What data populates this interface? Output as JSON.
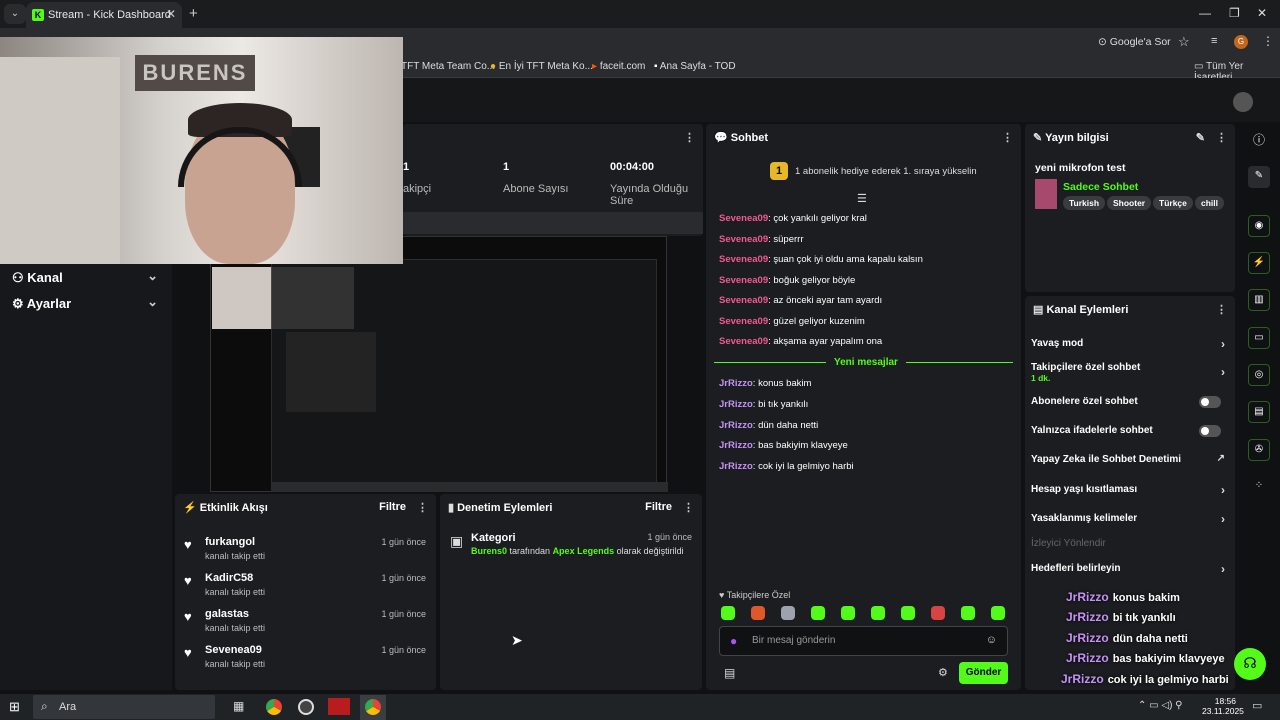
{
  "browser": {
    "tab_title": "Stream - Kick Dashboard",
    "address_actions": {
      "google_ask": "Google'a Sor"
    },
    "bookmarks": [
      "TFT Meta Team Co...",
      "En İyi TFT Meta Ko...",
      "faceit.com",
      "Ana Sayfa - TOD"
    ],
    "all_bookmarks": "Tüm Yer İşaretleri"
  },
  "webcam": {
    "sign_text": "BURENS"
  },
  "leftnav": {
    "items": [
      {
        "label": "Kanal"
      },
      {
        "label": "Ayarlar"
      }
    ]
  },
  "stats": {
    "items": [
      {
        "value": "1",
        "label": "akipçi"
      },
      {
        "value": "1",
        "label": "Abone Sayısı"
      },
      {
        "value": "00:04:00",
        "label": "Yayında Olduğu Süre"
      }
    ]
  },
  "activity": {
    "title": "Etkinlik Akışı",
    "filter": "Filtre",
    "items": [
      {
        "name": "furkangol",
        "sub": "kanalı takip etti",
        "time": "1 gün önce"
      },
      {
        "name": "KadirC58",
        "sub": "kanalı takip etti",
        "time": "1 gün önce"
      },
      {
        "name": "galastas",
        "sub": "kanalı takip etti",
        "time": "1 gün önce"
      },
      {
        "name": "Sevenea09",
        "sub": "kanalı takip etti",
        "time": "1 gün önce"
      }
    ]
  },
  "modlog": {
    "title": "Denetim Eylemleri",
    "filter": "Filtre",
    "item": {
      "title": "Kategori",
      "time": "1 gün önce",
      "actor": "Burens0",
      "mid": " tarafından ",
      "game": "Apex Legends",
      "tail": " olarak değiştirildi"
    }
  },
  "chat": {
    "title": "Sohbet",
    "promo": "1 abonelik hediye ederek 1. sıraya yükselin",
    "promo_num": "1",
    "messages": [
      {
        "user": "Sevenea09",
        "text": ": çok yankılı geliyor kral",
        "color": "pink"
      },
      {
        "user": "Sevenea09",
        "text": ": süperrr",
        "color": "pink"
      },
      {
        "user": "Sevenea09",
        "text": ": şuan çok iyi oldu ama kapalu kalsın",
        "color": "pink"
      },
      {
        "user": "Sevenea09",
        "text": ": boğuk geliyor böyle",
        "color": "pink"
      },
      {
        "user": "Sevenea09",
        "text": ": az önceki ayar tam ayardı",
        "color": "pink"
      },
      {
        "user": "Sevenea09",
        "text": ": güzel geliyor kuzenim",
        "color": "pink"
      },
      {
        "user": "Sevenea09",
        "text": ": akşama ayar yapalım ona",
        "color": "pink"
      },
      {
        "user": "JrRizzo",
        "text": ": konus bakim",
        "color": "purple"
      },
      {
        "user": "JrRizzo",
        "text": ": bi tık yankılı",
        "color": "purple"
      },
      {
        "user": "JrRizzo",
        "text": ": dün daha netti",
        "color": "purple"
      },
      {
        "user": "JrRizzo",
        "text": ": bas bakiyim klavyeye",
        "color": "purple"
      },
      {
        "user": "JrRizzo",
        "text": ": cok iyi la gelmiyo harbi",
        "color": "purple"
      }
    ],
    "new_messages": "Yeni mesajlar",
    "followers_only": "Takipçilere Özel",
    "input_placeholder": "Bir mesaj gönderin",
    "send": "Gönder"
  },
  "info": {
    "title": "Yayın bilgisi",
    "stream_title": "yeni mikrofon test",
    "category": "Sadece Sohbet",
    "tags": [
      "Turkish",
      "Shooter",
      "Türkçe",
      "chill"
    ]
  },
  "actions": {
    "title": "Kanal Eylemleri",
    "items": [
      {
        "label": "Yavaş mod"
      },
      {
        "label": "Takipçilere özel sohbet",
        "sub": "1 dk."
      },
      {
        "label": "Abonelere özel sohbet"
      },
      {
        "label": "Yalnızca ifadelerle sohbet"
      },
      {
        "label": "Yapay Zeka ile Sohbet Denetimi"
      },
      {
        "label": "Hesap yaşı kısıtlaması"
      },
      {
        "label": "Yasaklanmış kelimeler"
      },
      {
        "label": "İzleyici Yönlendir"
      },
      {
        "label": "Hedefleri belirleyin"
      }
    ]
  },
  "overlay": [
    {
      "user": "JrRizzo",
      "text": "konus bakim"
    },
    {
      "user": "JrRizzo",
      "text": "bi tık yankılı"
    },
    {
      "user": "JrRizzo",
      "text": "dün daha netti"
    },
    {
      "user": "JrRizzo",
      "text": "bas bakiyim klavyeye"
    },
    {
      "user": "JrRizzo",
      "text": "cok iyi la gelmiyo harbi"
    }
  ],
  "taskbar": {
    "search": "Ara",
    "time": "18:56",
    "date": "23.11.2025"
  },
  "colors": {
    "accent": "#53fc18",
    "pink_user": "#f25a8f",
    "purple_user": "#c592f7"
  }
}
